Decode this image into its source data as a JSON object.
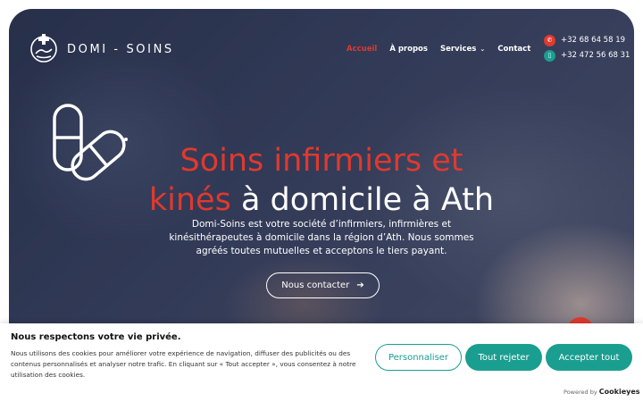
{
  "brand": {
    "name": "DOMI - SOINS"
  },
  "nav": {
    "items": [
      {
        "label": "Accueil",
        "active": true
      },
      {
        "label": "À propos"
      },
      {
        "label": "Services",
        "has_dropdown": true
      },
      {
        "label": "Contact"
      }
    ]
  },
  "contact": {
    "phones": [
      {
        "number": "+32 68 64 58 19",
        "icon": "phone-icon",
        "color": "#e0392e"
      },
      {
        "number": "+32 472 56 68 31",
        "icon": "mobile-icon",
        "color": "#1a9e90"
      }
    ]
  },
  "hero": {
    "title_line1": "Soins infirmiers et",
    "title_line2_highlight": "kinés",
    "title_line2_rest": " à domicile à Ath",
    "description": "Domi-Soins est votre société d’infirmiers, infirmières et kinésithérapeutes à domicile dans la région d’Ath. Nous sommes agréés toutes mutuelles et acceptons le tiers payant.",
    "cta_label": "Nous contacter",
    "cta_icon": "arrow-right-icon"
  },
  "cookie_banner": {
    "title": "Nous respectons votre vie privée.",
    "text": "Nous utilisons des cookies pour améliorer votre expérience de navigation, diffuser des publicités ou des contenus personnalisés et analyser notre trafic. En cliquant sur « Tout accepter », vous consentez à notre utilisation des cookies.",
    "buttons": {
      "customize": "Personnaliser",
      "reject": "Tout rejeter",
      "accept": "Accepter tout"
    },
    "powered_prefix": "Powered by",
    "powered_brand": "Cookieyes"
  },
  "colors": {
    "accent_red": "#e0392e",
    "accent_teal": "#1a9e90"
  }
}
